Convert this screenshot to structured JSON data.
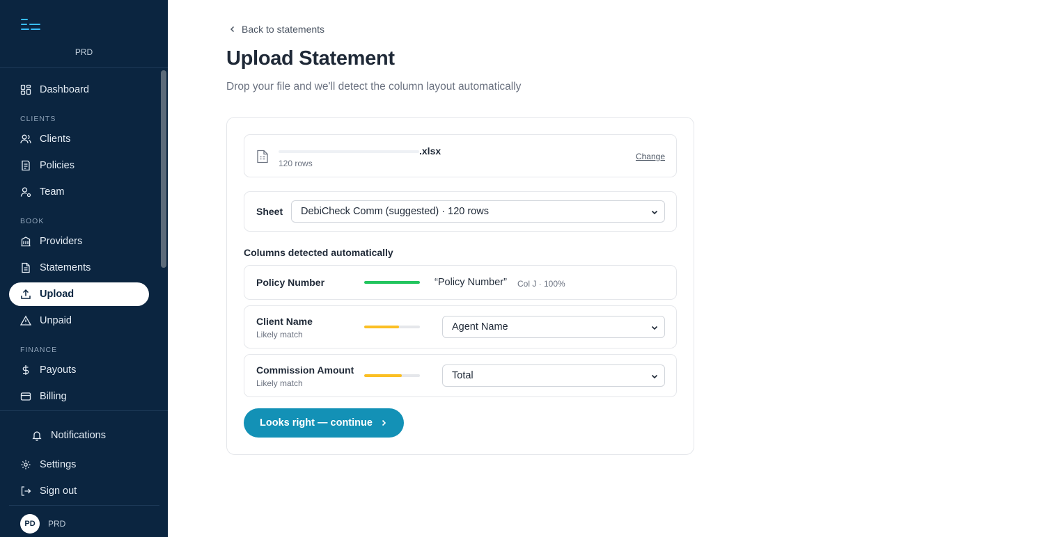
{
  "sidebar": {
    "brand_name": "PRD",
    "items": [
      {
        "label": "Dashboard",
        "icon": "dashboard-icon"
      },
      {
        "label": "Clients",
        "icon": "users-icon"
      },
      {
        "label": "Policies",
        "icon": "policies-icon"
      },
      {
        "label": "Team",
        "icon": "team-icon"
      },
      {
        "label": "Providers",
        "icon": "building-icon"
      },
      {
        "label": "Statements",
        "icon": "document-icon"
      },
      {
        "label": "Upload",
        "icon": "upload-icon"
      },
      {
        "label": "Unpaid",
        "icon": "warning-icon"
      },
      {
        "label": "Payouts",
        "icon": "dollar-icon"
      },
      {
        "label": "Billing",
        "icon": "credit-card-icon"
      }
    ],
    "active_item": "Upload",
    "sections": {
      "clients": "CLIENTS",
      "book": "BOOK",
      "finance": "FINANCE"
    },
    "bottom": {
      "notifications": "Notifications",
      "settings": "Settings",
      "sign_out": "Sign out",
      "avatar_initials": "PD",
      "user_name": "PRD"
    }
  },
  "main": {
    "back_link": "Back to statements",
    "title": "Upload Statement",
    "subtitle": "Drop your file and we'll detect the column layout automatically",
    "file": {
      "name_suffix": ".xlsx",
      "rows": "120 rows",
      "change_label": "Change"
    },
    "sheet": {
      "label": "Sheet",
      "selected": "DebiCheck Comm (suggested) · 120 rows"
    },
    "columns_title": "Columns detected automatically",
    "columns": [
      {
        "label": "Policy Number",
        "confidence": 1.0,
        "color": "#22c55e",
        "match_text": "“Policy Number”",
        "match_meta": "Col J · 100%"
      },
      {
        "label": "Client Name",
        "sub": "Likely match",
        "confidence": 0.62,
        "color": "#fbbf24",
        "selected": "Agent Name"
      },
      {
        "label": "Commission Amount",
        "sub": "Likely match",
        "confidence": 0.68,
        "color": "#fbbf24",
        "selected": "Total"
      }
    ],
    "continue_label": "Looks right — continue"
  },
  "colors": {
    "sidebar_bg": "#0b2540",
    "accent": "#1391b6",
    "brand": "#38bdf8"
  }
}
